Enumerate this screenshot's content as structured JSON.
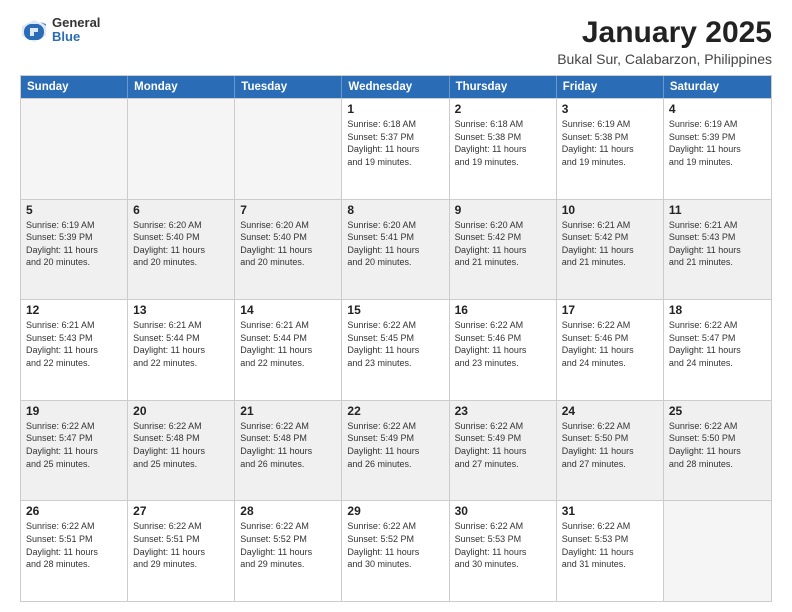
{
  "logo": {
    "general": "General",
    "blue": "Blue"
  },
  "title": "January 2025",
  "subtitle": "Bukal Sur, Calabarzon, Philippines",
  "days": [
    "Sunday",
    "Monday",
    "Tuesday",
    "Wednesday",
    "Thursday",
    "Friday",
    "Saturday"
  ],
  "weeks": [
    [
      {
        "day": "",
        "info": "",
        "empty": true
      },
      {
        "day": "",
        "info": "",
        "empty": true
      },
      {
        "day": "",
        "info": "",
        "empty": true
      },
      {
        "day": "1",
        "info": "Sunrise: 6:18 AM\nSunset: 5:37 PM\nDaylight: 11 hours\nand 19 minutes.",
        "empty": false
      },
      {
        "day": "2",
        "info": "Sunrise: 6:18 AM\nSunset: 5:38 PM\nDaylight: 11 hours\nand 19 minutes.",
        "empty": false
      },
      {
        "day": "3",
        "info": "Sunrise: 6:19 AM\nSunset: 5:38 PM\nDaylight: 11 hours\nand 19 minutes.",
        "empty": false
      },
      {
        "day": "4",
        "info": "Sunrise: 6:19 AM\nSunset: 5:39 PM\nDaylight: 11 hours\nand 19 minutes.",
        "empty": false
      }
    ],
    [
      {
        "day": "5",
        "info": "Sunrise: 6:19 AM\nSunset: 5:39 PM\nDaylight: 11 hours\nand 20 minutes.",
        "empty": false,
        "shaded": true
      },
      {
        "day": "6",
        "info": "Sunrise: 6:20 AM\nSunset: 5:40 PM\nDaylight: 11 hours\nand 20 minutes.",
        "empty": false,
        "shaded": true
      },
      {
        "day": "7",
        "info": "Sunrise: 6:20 AM\nSunset: 5:40 PM\nDaylight: 11 hours\nand 20 minutes.",
        "empty": false,
        "shaded": true
      },
      {
        "day": "8",
        "info": "Sunrise: 6:20 AM\nSunset: 5:41 PM\nDaylight: 11 hours\nand 20 minutes.",
        "empty": false,
        "shaded": true
      },
      {
        "day": "9",
        "info": "Sunrise: 6:20 AM\nSunset: 5:42 PM\nDaylight: 11 hours\nand 21 minutes.",
        "empty": false,
        "shaded": true
      },
      {
        "day": "10",
        "info": "Sunrise: 6:21 AM\nSunset: 5:42 PM\nDaylight: 11 hours\nand 21 minutes.",
        "empty": false,
        "shaded": true
      },
      {
        "day": "11",
        "info": "Sunrise: 6:21 AM\nSunset: 5:43 PM\nDaylight: 11 hours\nand 21 minutes.",
        "empty": false,
        "shaded": true
      }
    ],
    [
      {
        "day": "12",
        "info": "Sunrise: 6:21 AM\nSunset: 5:43 PM\nDaylight: 11 hours\nand 22 minutes.",
        "empty": false
      },
      {
        "day": "13",
        "info": "Sunrise: 6:21 AM\nSunset: 5:44 PM\nDaylight: 11 hours\nand 22 minutes.",
        "empty": false
      },
      {
        "day": "14",
        "info": "Sunrise: 6:21 AM\nSunset: 5:44 PM\nDaylight: 11 hours\nand 22 minutes.",
        "empty": false
      },
      {
        "day": "15",
        "info": "Sunrise: 6:22 AM\nSunset: 5:45 PM\nDaylight: 11 hours\nand 23 minutes.",
        "empty": false
      },
      {
        "day": "16",
        "info": "Sunrise: 6:22 AM\nSunset: 5:46 PM\nDaylight: 11 hours\nand 23 minutes.",
        "empty": false
      },
      {
        "day": "17",
        "info": "Sunrise: 6:22 AM\nSunset: 5:46 PM\nDaylight: 11 hours\nand 24 minutes.",
        "empty": false
      },
      {
        "day": "18",
        "info": "Sunrise: 6:22 AM\nSunset: 5:47 PM\nDaylight: 11 hours\nand 24 minutes.",
        "empty": false
      }
    ],
    [
      {
        "day": "19",
        "info": "Sunrise: 6:22 AM\nSunset: 5:47 PM\nDaylight: 11 hours\nand 25 minutes.",
        "empty": false,
        "shaded": true
      },
      {
        "day": "20",
        "info": "Sunrise: 6:22 AM\nSunset: 5:48 PM\nDaylight: 11 hours\nand 25 minutes.",
        "empty": false,
        "shaded": true
      },
      {
        "day": "21",
        "info": "Sunrise: 6:22 AM\nSunset: 5:48 PM\nDaylight: 11 hours\nand 26 minutes.",
        "empty": false,
        "shaded": true
      },
      {
        "day": "22",
        "info": "Sunrise: 6:22 AM\nSunset: 5:49 PM\nDaylight: 11 hours\nand 26 minutes.",
        "empty": false,
        "shaded": true
      },
      {
        "day": "23",
        "info": "Sunrise: 6:22 AM\nSunset: 5:49 PM\nDaylight: 11 hours\nand 27 minutes.",
        "empty": false,
        "shaded": true
      },
      {
        "day": "24",
        "info": "Sunrise: 6:22 AM\nSunset: 5:50 PM\nDaylight: 11 hours\nand 27 minutes.",
        "empty": false,
        "shaded": true
      },
      {
        "day": "25",
        "info": "Sunrise: 6:22 AM\nSunset: 5:50 PM\nDaylight: 11 hours\nand 28 minutes.",
        "empty": false,
        "shaded": true
      }
    ],
    [
      {
        "day": "26",
        "info": "Sunrise: 6:22 AM\nSunset: 5:51 PM\nDaylight: 11 hours\nand 28 minutes.",
        "empty": false
      },
      {
        "day": "27",
        "info": "Sunrise: 6:22 AM\nSunset: 5:51 PM\nDaylight: 11 hours\nand 29 minutes.",
        "empty": false
      },
      {
        "day": "28",
        "info": "Sunrise: 6:22 AM\nSunset: 5:52 PM\nDaylight: 11 hours\nand 29 minutes.",
        "empty": false
      },
      {
        "day": "29",
        "info": "Sunrise: 6:22 AM\nSunset: 5:52 PM\nDaylight: 11 hours\nand 30 minutes.",
        "empty": false
      },
      {
        "day": "30",
        "info": "Sunrise: 6:22 AM\nSunset: 5:53 PM\nDaylight: 11 hours\nand 30 minutes.",
        "empty": false
      },
      {
        "day": "31",
        "info": "Sunrise: 6:22 AM\nSunset: 5:53 PM\nDaylight: 11 hours\nand 31 minutes.",
        "empty": false
      },
      {
        "day": "",
        "info": "",
        "empty": true
      }
    ]
  ]
}
